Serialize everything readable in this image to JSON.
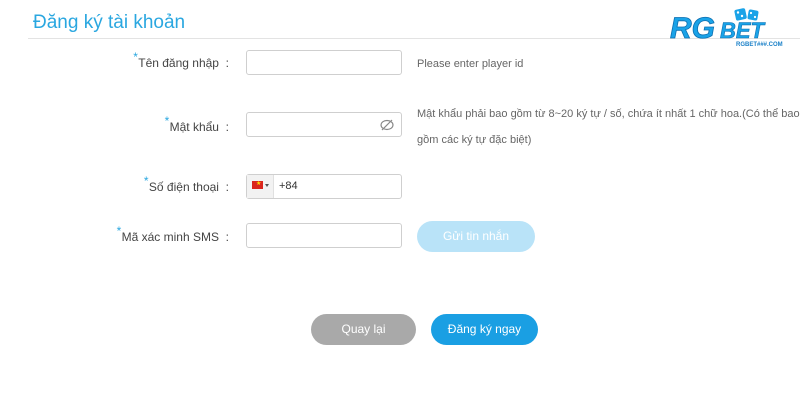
{
  "header": {
    "title": "Đăng ký tài khoản",
    "logo_text": "RGBET",
    "logo_subtext": "RGBET###.COM"
  },
  "form": {
    "username": {
      "label": "Tên đăng nhập",
      "required_mark": "*",
      "colon": ":",
      "value": "",
      "hint": "Please enter player id"
    },
    "password": {
      "label": "Mật khẩu",
      "required_mark": "*",
      "colon": ":",
      "value": "",
      "hint_line1": "Mật khẩu phải bao gồm từ 8~20 ký tự / số, chứa ít nhất 1 chữ hoa.(Có thể bao",
      "hint_line2": "gồm các ký tự đặc biệt)",
      "toggle_icon": "eye-slash-icon"
    },
    "phone": {
      "label": "Số điện thoại",
      "required_mark": "*",
      "colon": ":",
      "country_flag": "vietnam-flag",
      "dial_code": "+84",
      "value": ""
    },
    "sms": {
      "label": "Mã xác minh SMS",
      "required_mark": "*",
      "colon": ":",
      "value": "",
      "send_button_label": "Gửi tin nhắn"
    }
  },
  "actions": {
    "back_label": "Quay lại",
    "register_label": "Đăng ký ngay"
  },
  "colors": {
    "accent": "#1a9fe3",
    "accent_light": "#b9e3f8",
    "back_button": "#a9a9a9",
    "title": "#2aa7e0"
  }
}
